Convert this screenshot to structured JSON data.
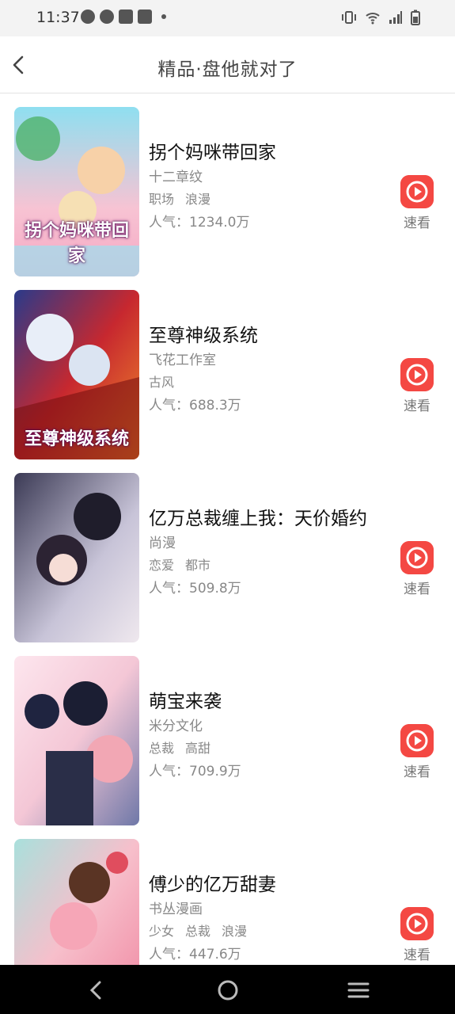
{
  "status_bar": {
    "time": "11:37",
    "left_icons": [
      "chat-icon",
      "check-circle-icon",
      "mail-icon",
      "bag-icon",
      "dot-icon"
    ],
    "right_icons": [
      "vibrate-icon",
      "wifi-icon",
      "signal-icon",
      "battery-icon"
    ]
  },
  "header": {
    "title": "精品·盘他就对了",
    "back_icon": "chevron-left-icon"
  },
  "comics": [
    {
      "title": "拐个妈咪带回家",
      "author": "十二章纹",
      "tags": [
        "职场",
        "浪漫"
      ],
      "popularity": "人气：1234.0万",
      "cover_text": "拐个妈咪带回家",
      "cover_colors": [
        "#f7b6c8",
        "#7fd3e8"
      ],
      "read_label": "速看"
    },
    {
      "title": "至尊神级系统",
      "author": "飞花工作室",
      "tags": [
        "古风"
      ],
      "popularity": "人气：688.3万",
      "cover_text": "至尊神级系统",
      "cover_colors": [
        "#c7282f",
        "#3c2a70"
      ],
      "read_label": "速看"
    },
    {
      "title": "亿万总裁缠上我：天价婚约",
      "author": "尚漫",
      "tags": [
        "恋爱",
        "都市"
      ],
      "popularity": "人气：509.8万",
      "cover_text": "",
      "cover_colors": [
        "#2d2a3c",
        "#b9b4cf"
      ],
      "read_label": "速看"
    },
    {
      "title": "萌宝来袭",
      "author": "米分文化",
      "tags": [
        "总裁",
        "高甜"
      ],
      "popularity": "人气：709.9万",
      "cover_text": "",
      "cover_colors": [
        "#f4c7d6",
        "#7f87b8"
      ],
      "read_label": "速看"
    },
    {
      "title": "傅少的亿万甜妻",
      "author": "书丛漫画",
      "tags": [
        "少女",
        "总裁",
        "浪漫"
      ],
      "popularity": "人气：447.6万",
      "cover_text": "",
      "cover_colors": [
        "#f6a6b7",
        "#9ad3d0"
      ],
      "read_label": "速看"
    }
  ],
  "nav_bar": {
    "back_icon": "nav-back-icon",
    "home_icon": "nav-home-icon",
    "menu_icon": "nav-menu-icon"
  }
}
